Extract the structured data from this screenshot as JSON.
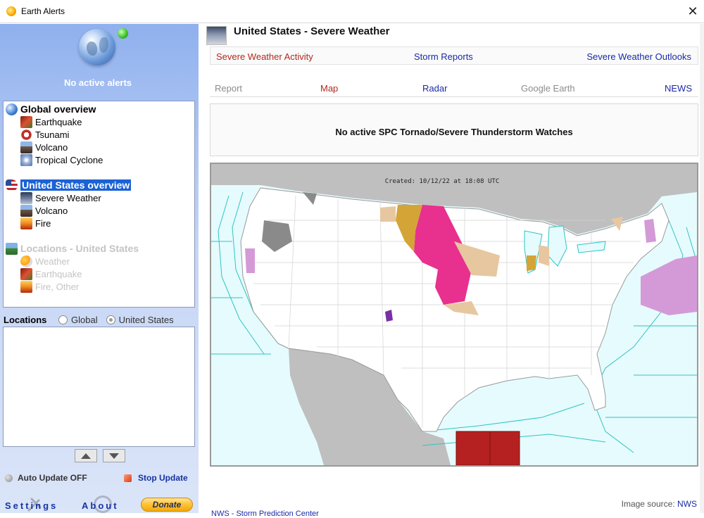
{
  "window": {
    "title": "Earth Alerts",
    "close_glyph": "✕"
  },
  "sidebar": {
    "status_text": "No active alerts",
    "tree": [
      {
        "label": "Global overview",
        "icon": "globe-icon"
      },
      {
        "label": "Earthquake",
        "icon": "earthquake-icon"
      },
      {
        "label": "Tsunami",
        "icon": "tsunami-icon"
      },
      {
        "label": "Volcano",
        "icon": "volcano-icon"
      },
      {
        "label": "Tropical Cyclone",
        "icon": "cyclone-icon"
      },
      {
        "label": "United States overview",
        "icon": "us-flag-icon",
        "selected": true
      },
      {
        "label": "Severe Weather",
        "icon": "severe-weather-icon"
      },
      {
        "label": "Volcano",
        "icon": "volcano-icon"
      },
      {
        "label": "Fire",
        "icon": "fire-icon"
      },
      {
        "label": "Locations - United States",
        "icon": "locations-icon",
        "disabled": true
      },
      {
        "label": "Weather",
        "icon": "weather-icon",
        "disabled": true
      },
      {
        "label": "Earthquake",
        "icon": "earthquake-icon",
        "disabled": true
      },
      {
        "label": "Fire, Other",
        "icon": "fire-icon",
        "disabled": true
      }
    ],
    "locations": {
      "label": "Locations",
      "options": [
        "Global",
        "United States"
      ],
      "selected": "United States"
    },
    "auto_update": "Auto Update OFF",
    "stop_update": "Stop Update",
    "settings": "Settings",
    "about": "About",
    "donate": "Donate"
  },
  "main": {
    "title": "United States - Severe Weather",
    "nav_primary": [
      {
        "label": "Severe Weather Activity",
        "color": "#b3291e"
      },
      {
        "label": "Storm Reports",
        "color": "#1a2aa6"
      },
      {
        "label": "Severe Weather Outlooks",
        "color": "#1a2aa6"
      }
    ],
    "nav_secondary": [
      {
        "label": "Report",
        "state": "disabled"
      },
      {
        "label": "Map",
        "state": "active"
      },
      {
        "label": "Radar",
        "state": "link"
      },
      {
        "label": "Google Earth",
        "state": "disabled"
      },
      {
        "label": "NEWS",
        "state": "link"
      }
    ],
    "watch_status": "No active SPC Tornado/Severe Thunderstorm Watches",
    "map": {
      "created_label": "Created: 10/12/22 at 18:08 UTC",
      "colors": {
        "land": "#ffffff",
        "ocean": "#e6fbfd",
        "water_lines": "#2ec4c4",
        "outside": "#bfbfbf",
        "magenta_warning": "#e8308e",
        "gold_watch": "#d4a437",
        "tan_advisory": "#e7c7a0",
        "lavender_marine": "#d49ad8",
        "red_gulf": "#b52121",
        "grey_fire": "#8a8a8a"
      }
    },
    "image_source_label": "Image source:",
    "image_source_link": "NWS",
    "footer_partial": "NWS - Storm Prediction Center"
  }
}
